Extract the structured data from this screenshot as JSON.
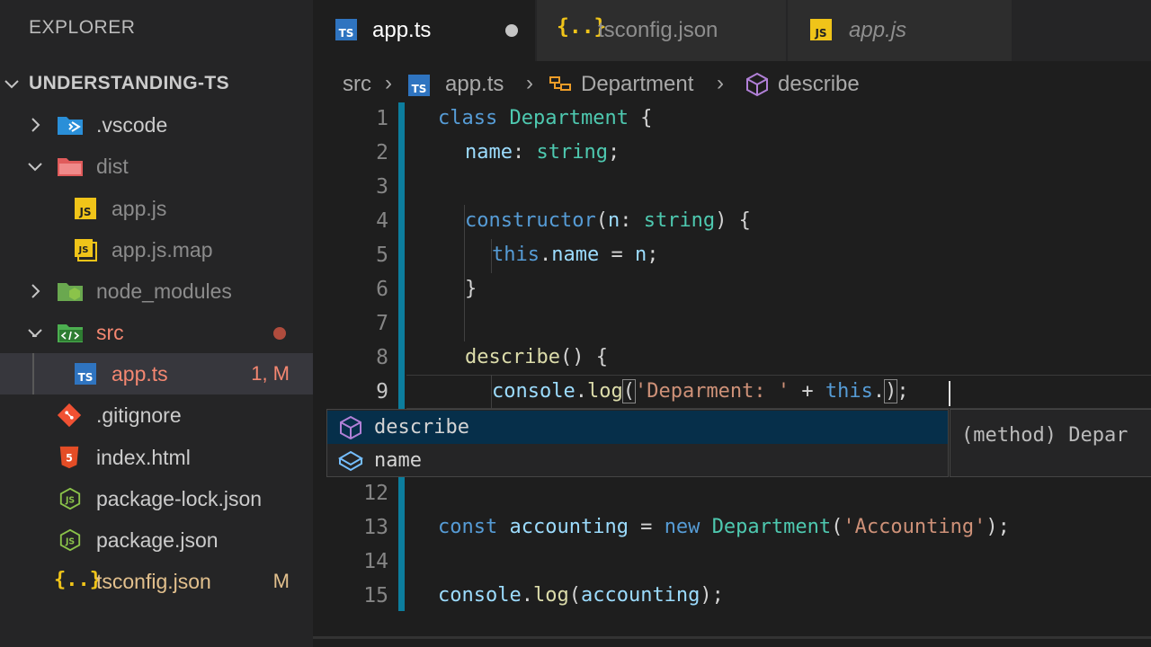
{
  "sidebar": {
    "title": "EXPLORER",
    "section": "UNDERSTANDING-TS",
    "items": [
      {
        "label": ".vscode"
      },
      {
        "label": "dist"
      },
      {
        "label": "app.js"
      },
      {
        "label": "app.js.map"
      },
      {
        "label": "node_modules"
      },
      {
        "label": "src"
      },
      {
        "label": "app.ts",
        "badge": "1, M"
      },
      {
        "label": ".gitignore"
      },
      {
        "label": "index.html"
      },
      {
        "label": "package-lock.json"
      },
      {
        "label": "package.json"
      },
      {
        "label": "tsconfig.json",
        "badge": "M"
      }
    ]
  },
  "tabs": [
    {
      "label": "app.ts",
      "icon": "TS"
    },
    {
      "label": "tsconfig.json",
      "icon": "{..}"
    },
    {
      "label": "app.js",
      "icon": "JS"
    }
  ],
  "breadcrumb": {
    "src": "src",
    "file": "app.ts",
    "class": "Department",
    "method": "describe",
    "file_icon": "TS"
  },
  "code": {
    "line_numbers": [
      "1",
      "2",
      "3",
      "4",
      "5",
      "6",
      "7",
      "8",
      "9",
      "12",
      "13",
      "14",
      "15"
    ],
    "l1": {
      "a": "class",
      "b": "Department",
      "c": " {"
    },
    "l2": {
      "a": "name",
      "b": ": ",
      "c": "string",
      "d": ";"
    },
    "l4": {
      "a": "constructor",
      "b": "(",
      "c": "n",
      "d": ": ",
      "e": "string",
      "f": ") {"
    },
    "l5": {
      "a": "this",
      "b": ".",
      "c": "name",
      "d": " = ",
      "e": "n",
      "f": ";"
    },
    "l6": {
      "a": "}"
    },
    "l8": {
      "a": "describe",
      "b": "() {"
    },
    "l9": {
      "a": "console",
      "b": ".",
      "c": "log",
      "d": "(",
      "e": "'Deparment: '",
      "f": " + ",
      "g": "this",
      "h": ".",
      "i": ")",
      "j": ";"
    },
    "l13": {
      "a": "const",
      "b": " ",
      "c": "accounting",
      "d": " = ",
      "e": "new",
      "f": " ",
      "g": "Department",
      "h": "(",
      "i": "'Accounting'",
      "j": ");"
    },
    "l15": {
      "a": "console",
      "b": ".",
      "c": "log",
      "d": "(",
      "e": "accounting",
      "f": ");"
    }
  },
  "suggest": {
    "items": [
      {
        "label": "describe",
        "icon": "method-cube-icon"
      },
      {
        "label": "name",
        "icon": "field-icon"
      }
    ],
    "detail": "(method) Depar"
  },
  "colors": {
    "keyword": "#569cd6",
    "class": "#4ec9b0",
    "property": "#9cdcfe",
    "function": "#dcdcaa",
    "string": "#ce9178",
    "ts_blue": "#2f74c0",
    "js_yellow": "#f0c419",
    "modified": "#e2c08d",
    "error": "#f48771"
  }
}
